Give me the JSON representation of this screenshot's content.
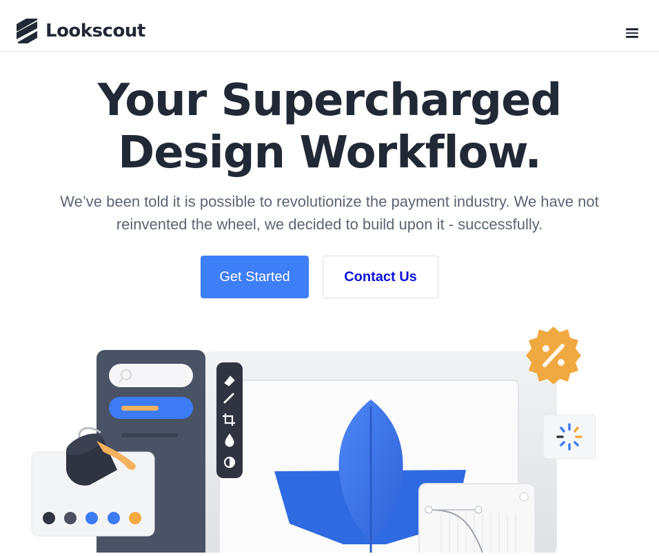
{
  "header": {
    "brand_name": "Lookscout",
    "logo_icon": "stacked-stripes-logo-icon",
    "menu_icon": "hamburger-menu-icon"
  },
  "hero": {
    "title_line1": "Your Supercharged",
    "title_line2": "Design Workflow.",
    "subtitle_line1": "We’ve been told it is possible to revolutionize the payment industry. We have not",
    "subtitle_line2": "reinvented the wheel, we decided to build upon it - successfully.",
    "primary_button": "Get Started",
    "secondary_button": "Contact Us"
  },
  "illustration": {
    "icons": [
      "search-icon",
      "pen-tool-icon",
      "brush-icon",
      "crop-icon",
      "droplet-icon",
      "contrast-icon",
      "percent-badge-icon",
      "loading-spinner-icon",
      "paint-bucket-icon"
    ],
    "swatches": [
      "#2f3440",
      "#4a5060",
      "#3d7bf5",
      "#3d7bf5",
      "#f4a940"
    ]
  },
  "colors": {
    "primary": "#3e7ef7",
    "link": "#0b11d6",
    "heading": "#212936",
    "body": "#5b6473"
  }
}
